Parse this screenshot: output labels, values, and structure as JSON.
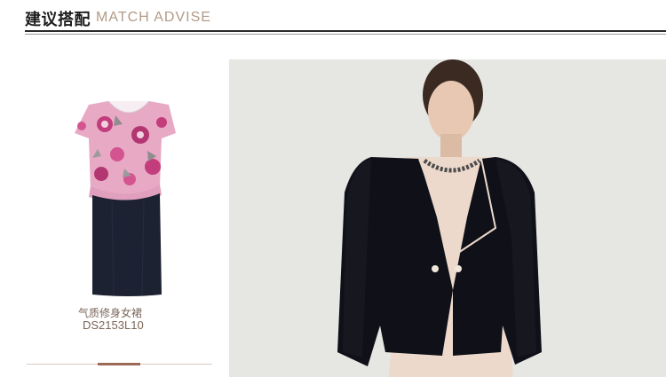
{
  "header": {
    "title_cn": "建议搭配",
    "title_en": "MATCH ADVISE"
  },
  "product": {
    "name": "气质修身女裙",
    "code": "DS2153L10",
    "image_icon": "floral-top-dress-image"
  },
  "model_photo": {
    "image_icon": "model-black-blazer-photo"
  },
  "colors": {
    "title_en": "#b39a86",
    "caption": "#7a6558",
    "slider_thumb": "#9c6b58",
    "photo_bg": "#e6e6e3"
  }
}
